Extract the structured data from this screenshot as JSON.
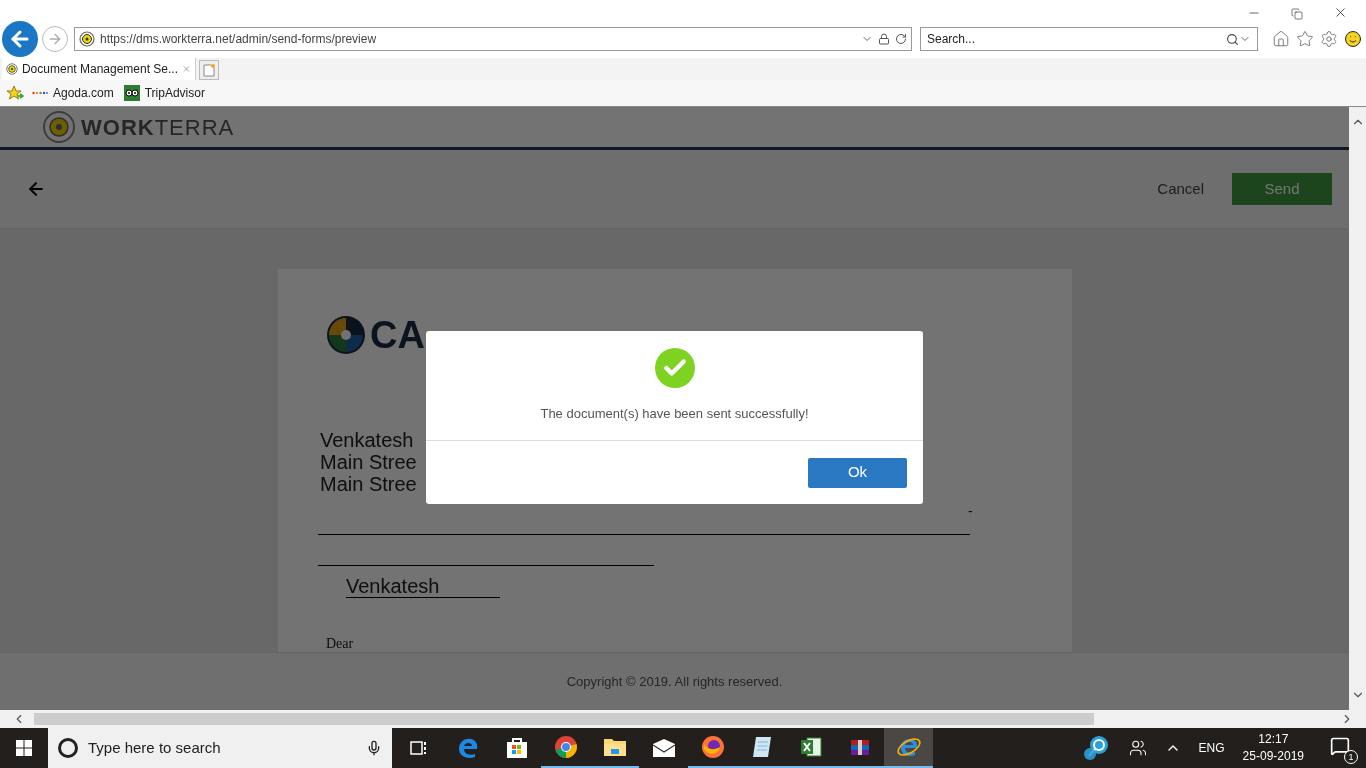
{
  "browser": {
    "url": "https://dms.workterra.net/admin/send-forms/preview",
    "search": {
      "placeholder": "Search..."
    },
    "tabs": [
      {
        "title": "Document Management Se...",
        "selected": true
      }
    ],
    "favorites": [
      {
        "label": "Agoda.com",
        "kind": "agoda"
      },
      {
        "label": "TripAdvisor",
        "kind": "tripadvisor"
      }
    ]
  },
  "app": {
    "logo": {
      "bold": "WORK",
      "light": "TERRA"
    },
    "toolbar": {
      "cancel": "Cancel",
      "send": "Send"
    },
    "document": {
      "logo_text": "CA",
      "address_lines": [
        "Venkatesh",
        "Main Stree",
        "Main Stree"
      ],
      "dash": "-",
      "signature": "Venkatesh",
      "greeting": "Dear"
    },
    "footer": "Copyright © 2019. All rights reserved."
  },
  "dialog": {
    "message": "The document(s) have been sent successfully!",
    "ok": "Ok"
  },
  "taskbar": {
    "search": {
      "placeholder": "Type here to search"
    },
    "apps": [
      {
        "kind": "taskview",
        "running": false,
        "selected": false
      },
      {
        "kind": "edge",
        "running": false,
        "selected": false
      },
      {
        "kind": "store",
        "running": false,
        "selected": false
      },
      {
        "kind": "chrome",
        "running": true,
        "selected": false
      },
      {
        "kind": "explorer",
        "running": true,
        "selected": false
      },
      {
        "kind": "mail",
        "running": false,
        "selected": false
      },
      {
        "kind": "firefox",
        "running": true,
        "selected": false
      },
      {
        "kind": "notepad",
        "running": true,
        "selected": false
      },
      {
        "kind": "excel",
        "running": true,
        "selected": false
      },
      {
        "kind": "winrar",
        "running": true,
        "selected": false
      },
      {
        "kind": "ie",
        "running": true,
        "selected": true
      }
    ],
    "language": "ENG",
    "time": "12:17",
    "date": "25-09-2019",
    "notifications": "1"
  }
}
